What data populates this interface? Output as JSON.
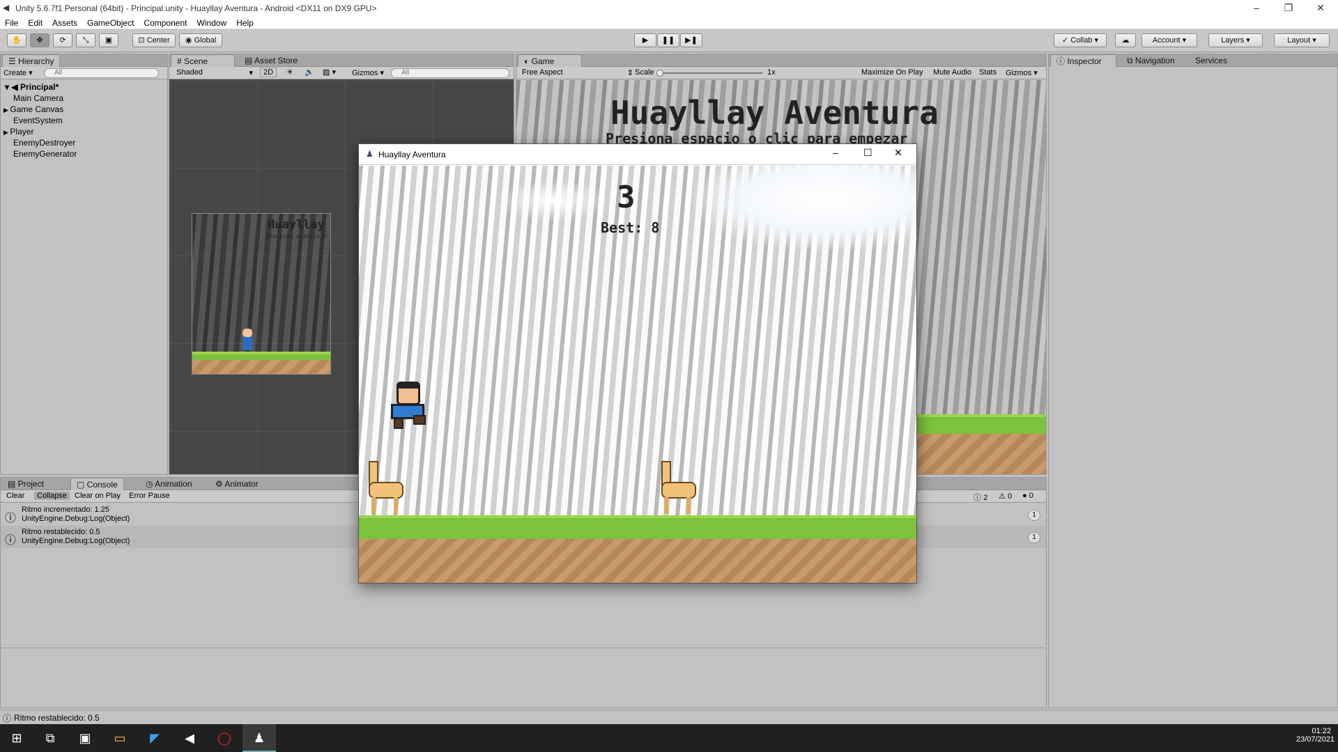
{
  "title": "Unity 5.6.7f1 Personal (64bit) - Principal.unity - Huayllay Aventura - Android <DX11 on DX9 GPU>",
  "menu": [
    "File",
    "Edit",
    "Assets",
    "GameObject",
    "Component",
    "Window",
    "Help"
  ],
  "toolbar": {
    "center": "Center",
    "global": "Global",
    "collab": "Collab",
    "account": "Account",
    "layers": "Layers",
    "layout": "Layout"
  },
  "hierarchy": {
    "tab": "Hierarchy",
    "create": "Create",
    "search": "All",
    "scene": "Principal*",
    "items": [
      "Main Camera",
      "Game Canvas",
      "EventSystem",
      "Player",
      "EnemyDestroyer",
      "EnemyGenerator"
    ]
  },
  "scene": {
    "tab": "Scene",
    "store_tab": "Asset Store",
    "shaded": "Shaded",
    "mode2d": "2D",
    "gizmos": "Gizmos",
    "search": "All",
    "title": "Huayllay Ave",
    "subtitle": "Presiona espacio o clic p"
  },
  "game": {
    "tab": "Game",
    "aspect": "Free Aspect",
    "scale": "Scale",
    "scale_val": "1x",
    "maximize": "Maximize On Play",
    "mute": "Mute Audio",
    "stats": "Stats",
    "gizmos": "Gizmos",
    "title": "Huayllay Aventura",
    "subtitle": "Presiona espacio o clic para empezar"
  },
  "inspector": {
    "tab": "Inspector",
    "nav": "Navigation",
    "services": "Services"
  },
  "bottom": {
    "tabs": [
      "Project",
      "Console",
      "Animation",
      "Animator"
    ],
    "buttons": [
      "Clear",
      "Collapse",
      "Clear on Play",
      "Error Pause"
    ],
    "counts": [
      "2",
      "0",
      "0"
    ],
    "logs": [
      {
        "line1": "Ritmo incrementado: 1.25",
        "line2": "UnityEngine.Debug:Log(Object)",
        "count": "1"
      },
      {
        "line1": "Ritmo restablecido: 0.5",
        "line2": "UnityEngine.Debug:Log(Object)",
        "count": "1"
      }
    ]
  },
  "status": "Ritmo restablecido: 0.5",
  "player_window": {
    "title": "Huayllay Aventura",
    "score": "3",
    "best": "Best: 8"
  },
  "clock": {
    "time": "01:22",
    "date": "23/07/2021"
  }
}
